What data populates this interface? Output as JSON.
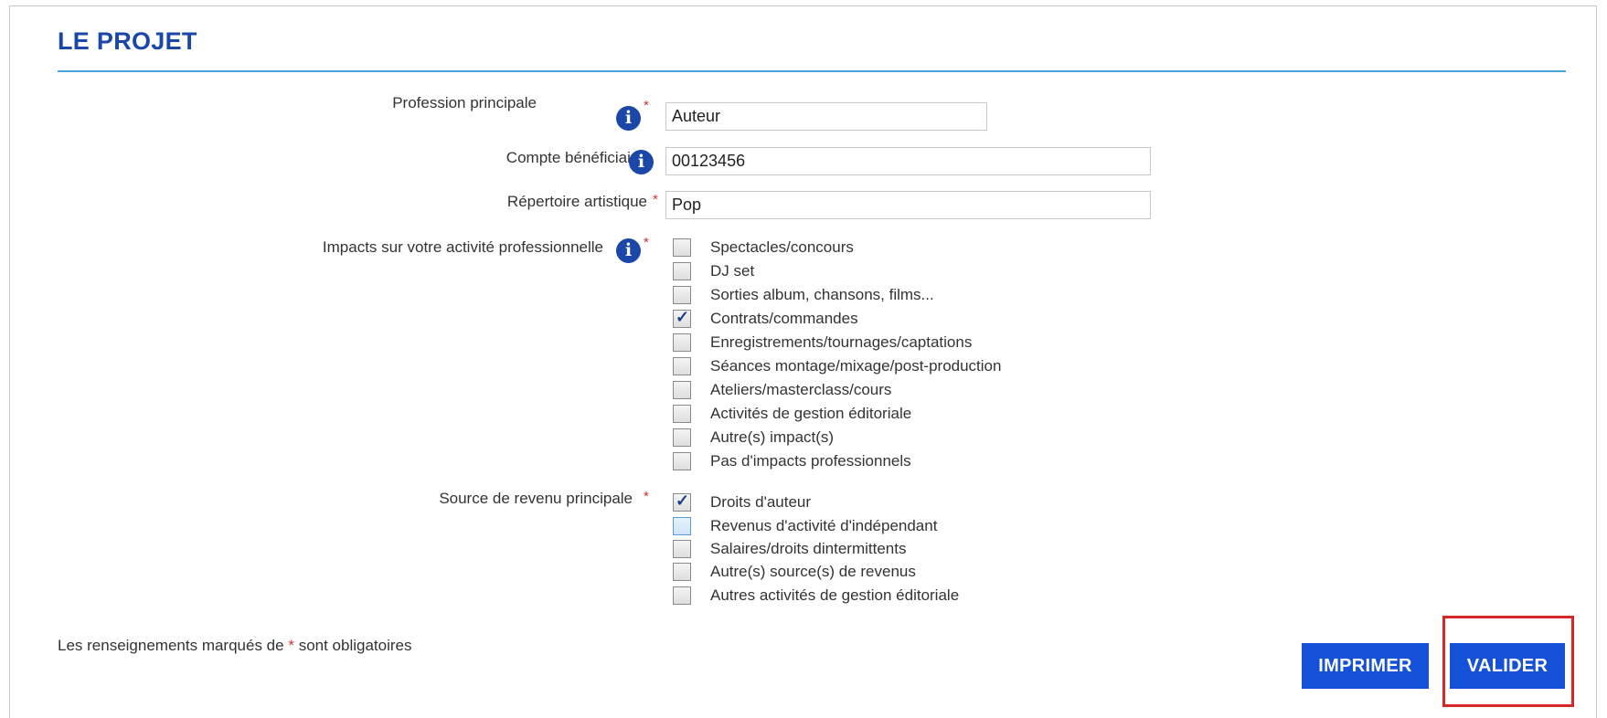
{
  "section_title": "LE PROJET",
  "required_mark": "*",
  "fields": {
    "profession": {
      "label": "Profession principale",
      "value": "Auteur"
    },
    "compte": {
      "label": "Compte bénéficiaire",
      "value": "00123456"
    },
    "repertoire": {
      "label": "Répertoire artistique",
      "value": "Pop"
    }
  },
  "impacts": {
    "label": "Impacts sur votre activité professionnelle",
    "options": [
      {
        "label": "Spectacles/concours",
        "checked": false
      },
      {
        "label": "DJ set",
        "checked": false
      },
      {
        "label": "Sorties album, chansons, films...",
        "checked": false
      },
      {
        "label": "Contrats/commandes",
        "checked": true
      },
      {
        "label": "Enregistrements/tournages/captations",
        "checked": false
      },
      {
        "label": "Séances montage/mixage/post-production",
        "checked": false
      },
      {
        "label": "Ateliers/masterclass/cours",
        "checked": false
      },
      {
        "label": "Activités de gestion éditoriale",
        "checked": false
      },
      {
        "label": "Autre(s) impact(s)",
        "checked": false
      },
      {
        "label": "Pas d'impacts professionnels",
        "checked": false
      }
    ]
  },
  "revenu": {
    "label": "Source de revenu principale",
    "options": [
      {
        "label": "Droits d'auteur",
        "checked": true
      },
      {
        "label": "Revenus d'activité d'indépendant",
        "checked": false
      },
      {
        "label": "Salaires/droits dintermittents",
        "checked": false
      },
      {
        "label": "Autre(s) source(s) de revenus",
        "checked": false
      },
      {
        "label": "Autres activités de gestion éditoriale",
        "checked": false
      }
    ]
  },
  "footer": {
    "note_prefix": "Les renseignements marqués de",
    "note_suffix": "sont obligatoires",
    "print_label": "IMPRIMER",
    "submit_label": "VALIDER"
  },
  "icons": {
    "info": "info-icon",
    "check": "check-icon"
  },
  "colors": {
    "accent": "#1a47a8",
    "button": "#1450d8",
    "rule": "#4aa3df",
    "required": "#d32f2f",
    "highlight": "#d62828"
  }
}
